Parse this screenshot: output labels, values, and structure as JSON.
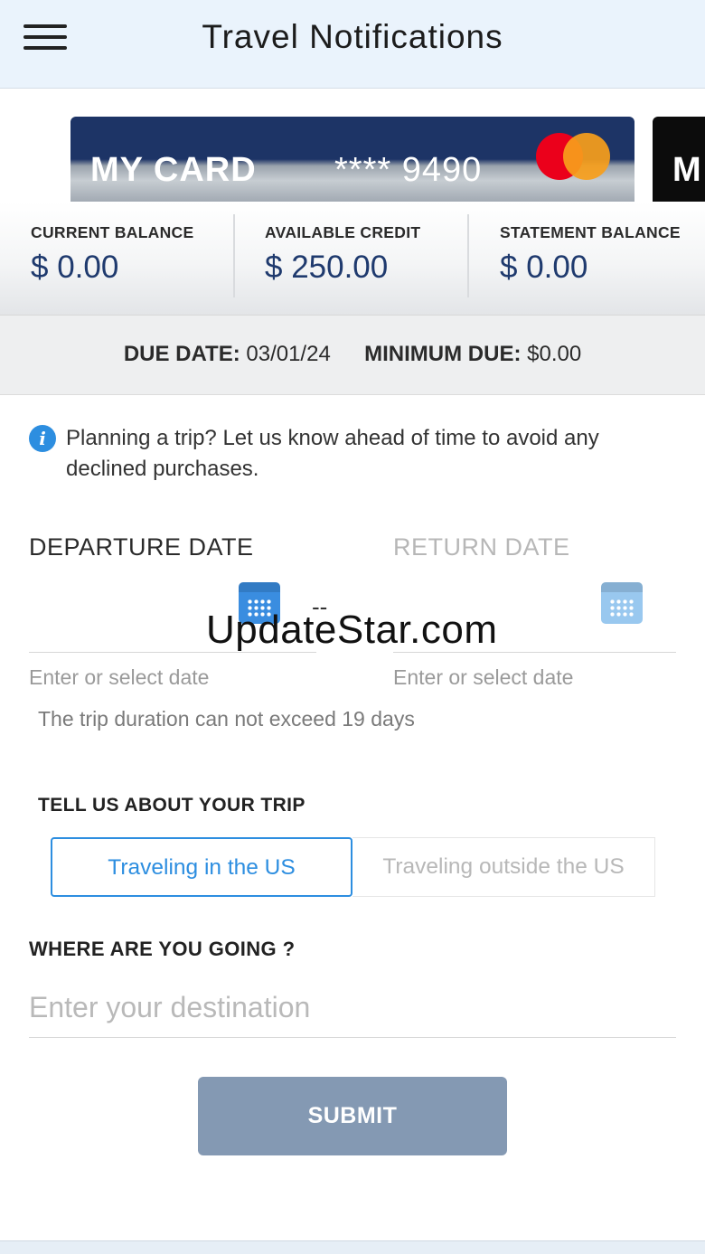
{
  "header": {
    "title": "Travel Notifications",
    "menu_icon": "hamburger-menu-icon"
  },
  "cards": [
    {
      "name": "MY CARD",
      "number": "**** 9490",
      "brand": "mastercard"
    },
    {
      "name": "M"
    }
  ],
  "balances": [
    {
      "label": "CURRENT BALANCE",
      "value": "$ 0.00"
    },
    {
      "label": "AVAILABLE CREDIT",
      "value": "$ 250.00"
    },
    {
      "label": "STATEMENT BALANCE",
      "value": "$ 0.00"
    }
  ],
  "due": {
    "date_label": "DUE DATE:",
    "date_value": "03/01/24",
    "minimum_label": "MINIMUM DUE:",
    "minimum_value": "$0.00"
  },
  "info": {
    "icon": "info-icon",
    "text": "Planning a trip? Let us know ahead of time to avoid any declined purchases."
  },
  "dates": {
    "departure_label": "DEPARTURE DATE",
    "return_label": "RETURN DATE",
    "separator": "--",
    "departure_hint": "Enter or select date",
    "return_hint": "Enter or select date",
    "duration_note": "The trip duration can not exceed 19 days"
  },
  "watermark": "UpdateStar.com",
  "trip": {
    "label": "TELL US ABOUT YOUR TRIP",
    "options": [
      "Traveling in the US",
      "Traveling outside the US"
    ],
    "selected": "Traveling in the US"
  },
  "destination": {
    "label": "WHERE ARE YOU GOING ?",
    "placeholder": "Enter your destination"
  },
  "submit_label": "SUBMIT",
  "colors": {
    "header_bg": "#eaf3fc",
    "accent": "#2d8ee0",
    "balance_value": "#1f3a6e",
    "submit_bg": "#8499b3",
    "card_navy": "#1d3466"
  }
}
